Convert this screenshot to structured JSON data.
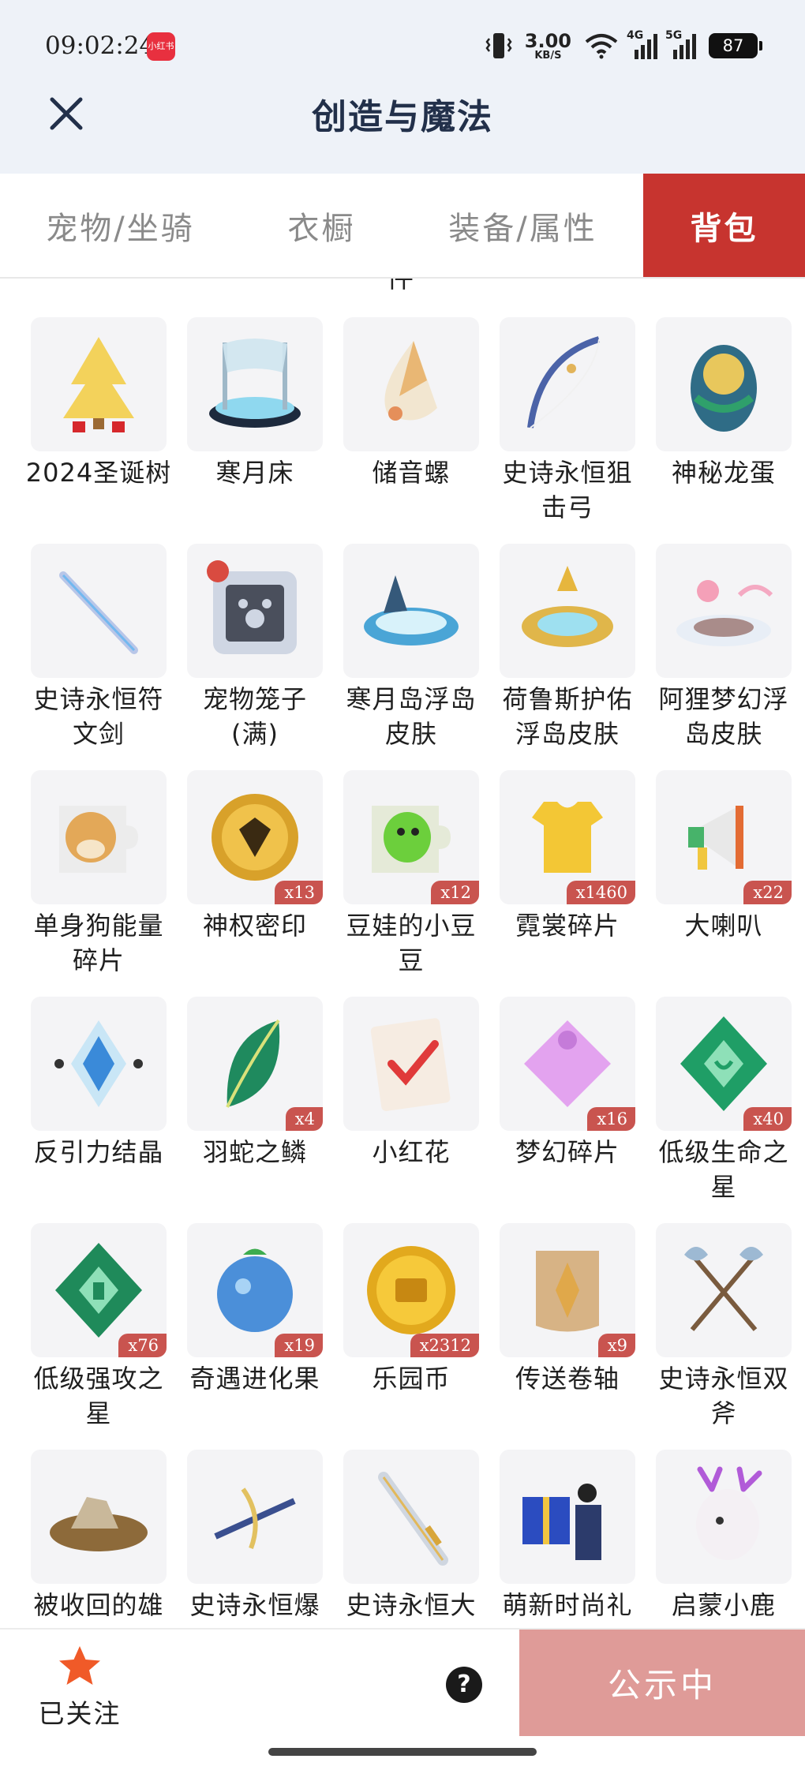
{
  "status_bar": {
    "time": "09:02:24",
    "app_badge": "小红书",
    "net_speed_value": "3.00",
    "net_speed_unit": "KB/S",
    "signal_1_label": "4G",
    "signal_2_label": "5G",
    "battery": "87"
  },
  "header": {
    "title": "创造与魔法"
  },
  "tabs": [
    {
      "label": "宠物/坐骑",
      "active": false
    },
    {
      "label": "衣橱",
      "active": false
    },
    {
      "label": "装备/属性",
      "active": false
    },
    {
      "label": "背包",
      "active": true
    }
  ],
  "clipped_top_text": "件",
  "items": [
    {
      "name": "2024圣诞树",
      "qty": "",
      "icon": "christmas-tree-icon"
    },
    {
      "name": "寒月床",
      "qty": "",
      "icon": "bed-icon"
    },
    {
      "name": "储音螺",
      "qty": "",
      "icon": "conch-icon"
    },
    {
      "name": "史诗永恒狙击弓",
      "qty": "",
      "icon": "bow-icon"
    },
    {
      "name": "神秘龙蛋",
      "qty": "",
      "icon": "dragon-egg-icon"
    },
    {
      "name": "史诗永恒符文剑",
      "qty": "",
      "icon": "rune-sword-icon"
    },
    {
      "name": "宠物笼子(满)",
      "qty": "",
      "icon": "pet-cage-icon"
    },
    {
      "name": "寒月岛浮岛皮肤",
      "qty": "",
      "icon": "floating-island-icon"
    },
    {
      "name": "荷鲁斯护佑浮岛皮肤",
      "qty": "",
      "icon": "golden-island-icon"
    },
    {
      "name": "阿狸梦幻浮岛皮肤",
      "qty": "",
      "icon": "dream-island-icon"
    },
    {
      "name": "单身狗能量碎片",
      "qty": "",
      "icon": "doge-puzzle-icon"
    },
    {
      "name": "神权密印",
      "qty": "x13",
      "icon": "gold-seal-icon"
    },
    {
      "name": "豆娃的小豆豆",
      "qty": "x12",
      "icon": "bean-puzzle-icon"
    },
    {
      "name": "霓裳碎片",
      "qty": "x1460",
      "icon": "shirt-icon"
    },
    {
      "name": "大喇叭",
      "qty": "x22",
      "icon": "megaphone-icon"
    },
    {
      "name": "反引力结晶",
      "qty": "",
      "icon": "crystal-icon"
    },
    {
      "name": "羽蛇之鳞",
      "qty": "x4",
      "icon": "scale-leaf-icon"
    },
    {
      "name": "小红花",
      "qty": "",
      "icon": "notebook-check-icon"
    },
    {
      "name": "梦幻碎片",
      "qty": "x16",
      "icon": "purple-puzzle-icon"
    },
    {
      "name": "低级生命之星",
      "qty": "x40",
      "icon": "green-gem-icon"
    },
    {
      "name": "低级强攻之星",
      "qty": "x76",
      "icon": "green-shield-gem-icon"
    },
    {
      "name": "奇遇进化果",
      "qty": "x19",
      "icon": "blue-fruit-icon"
    },
    {
      "name": "乐园币",
      "qty": "x2312",
      "icon": "coin-icon"
    },
    {
      "name": "传送卷轴",
      "qty": "x9",
      "icon": "scroll-icon"
    },
    {
      "name": "史诗永恒双斧",
      "qty": "",
      "icon": "double-axe-icon"
    },
    {
      "name": "被收回的雄",
      "qty": "",
      "icon": "ruins-icon"
    },
    {
      "name": "史诗永恒爆",
      "qty": "",
      "icon": "crossbow-icon"
    },
    {
      "name": "史诗永恒大",
      "qty": "",
      "icon": "greatsword-icon"
    },
    {
      "name": "萌新时尚礼",
      "qty": "",
      "icon": "gift-box-icon"
    },
    {
      "name": "启蒙小鹿",
      "qty": "",
      "icon": "deer-icon"
    }
  ],
  "bottom_bar": {
    "follow_label": "已关注",
    "help_label": "?",
    "notice_button": "公示中"
  },
  "colors": {
    "accent_red": "#c7342f",
    "qty_badge": "#c9544f",
    "notice_button": "#df9b98",
    "header_bg": "#eef2f8",
    "star": "#f05a28"
  }
}
